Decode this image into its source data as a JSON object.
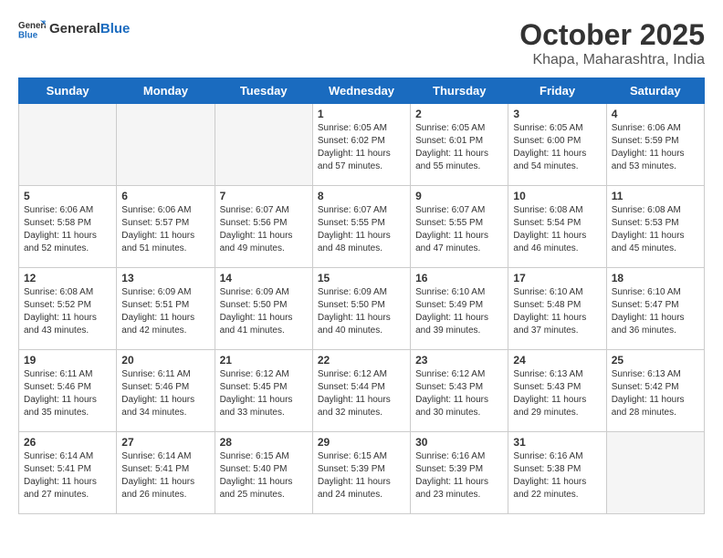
{
  "header": {
    "logo_general": "General",
    "logo_blue": "Blue",
    "title": "October 2025",
    "subtitle": "Khapa, Maharashtra, India"
  },
  "weekdays": [
    "Sunday",
    "Monday",
    "Tuesday",
    "Wednesday",
    "Thursday",
    "Friday",
    "Saturday"
  ],
  "weeks": [
    [
      {
        "day": "",
        "empty": true
      },
      {
        "day": "",
        "empty": true
      },
      {
        "day": "",
        "empty": true
      },
      {
        "day": "1",
        "sunrise": "6:05 AM",
        "sunset": "6:02 PM",
        "daylight": "11 hours and 57 minutes."
      },
      {
        "day": "2",
        "sunrise": "6:05 AM",
        "sunset": "6:01 PM",
        "daylight": "11 hours and 55 minutes."
      },
      {
        "day": "3",
        "sunrise": "6:05 AM",
        "sunset": "6:00 PM",
        "daylight": "11 hours and 54 minutes."
      },
      {
        "day": "4",
        "sunrise": "6:06 AM",
        "sunset": "5:59 PM",
        "daylight": "11 hours and 53 minutes."
      }
    ],
    [
      {
        "day": "5",
        "sunrise": "6:06 AM",
        "sunset": "5:58 PM",
        "daylight": "11 hours and 52 minutes."
      },
      {
        "day": "6",
        "sunrise": "6:06 AM",
        "sunset": "5:57 PM",
        "daylight": "11 hours and 51 minutes."
      },
      {
        "day": "7",
        "sunrise": "6:07 AM",
        "sunset": "5:56 PM",
        "daylight": "11 hours and 49 minutes."
      },
      {
        "day": "8",
        "sunrise": "6:07 AM",
        "sunset": "5:55 PM",
        "daylight": "11 hours and 48 minutes."
      },
      {
        "day": "9",
        "sunrise": "6:07 AM",
        "sunset": "5:55 PM",
        "daylight": "11 hours and 47 minutes."
      },
      {
        "day": "10",
        "sunrise": "6:08 AM",
        "sunset": "5:54 PM",
        "daylight": "11 hours and 46 minutes."
      },
      {
        "day": "11",
        "sunrise": "6:08 AM",
        "sunset": "5:53 PM",
        "daylight": "11 hours and 45 minutes."
      }
    ],
    [
      {
        "day": "12",
        "sunrise": "6:08 AM",
        "sunset": "5:52 PM",
        "daylight": "11 hours and 43 minutes."
      },
      {
        "day": "13",
        "sunrise": "6:09 AM",
        "sunset": "5:51 PM",
        "daylight": "11 hours and 42 minutes."
      },
      {
        "day": "14",
        "sunrise": "6:09 AM",
        "sunset": "5:50 PM",
        "daylight": "11 hours and 41 minutes."
      },
      {
        "day": "15",
        "sunrise": "6:09 AM",
        "sunset": "5:50 PM",
        "daylight": "11 hours and 40 minutes."
      },
      {
        "day": "16",
        "sunrise": "6:10 AM",
        "sunset": "5:49 PM",
        "daylight": "11 hours and 39 minutes."
      },
      {
        "day": "17",
        "sunrise": "6:10 AM",
        "sunset": "5:48 PM",
        "daylight": "11 hours and 37 minutes."
      },
      {
        "day": "18",
        "sunrise": "6:10 AM",
        "sunset": "5:47 PM",
        "daylight": "11 hours and 36 minutes."
      }
    ],
    [
      {
        "day": "19",
        "sunrise": "6:11 AM",
        "sunset": "5:46 PM",
        "daylight": "11 hours and 35 minutes."
      },
      {
        "day": "20",
        "sunrise": "6:11 AM",
        "sunset": "5:46 PM",
        "daylight": "11 hours and 34 minutes."
      },
      {
        "day": "21",
        "sunrise": "6:12 AM",
        "sunset": "5:45 PM",
        "daylight": "11 hours and 33 minutes."
      },
      {
        "day": "22",
        "sunrise": "6:12 AM",
        "sunset": "5:44 PM",
        "daylight": "11 hours and 32 minutes."
      },
      {
        "day": "23",
        "sunrise": "6:12 AM",
        "sunset": "5:43 PM",
        "daylight": "11 hours and 30 minutes."
      },
      {
        "day": "24",
        "sunrise": "6:13 AM",
        "sunset": "5:43 PM",
        "daylight": "11 hours and 29 minutes."
      },
      {
        "day": "25",
        "sunrise": "6:13 AM",
        "sunset": "5:42 PM",
        "daylight": "11 hours and 28 minutes."
      }
    ],
    [
      {
        "day": "26",
        "sunrise": "6:14 AM",
        "sunset": "5:41 PM",
        "daylight": "11 hours and 27 minutes."
      },
      {
        "day": "27",
        "sunrise": "6:14 AM",
        "sunset": "5:41 PM",
        "daylight": "11 hours and 26 minutes."
      },
      {
        "day": "28",
        "sunrise": "6:15 AM",
        "sunset": "5:40 PM",
        "daylight": "11 hours and 25 minutes."
      },
      {
        "day": "29",
        "sunrise": "6:15 AM",
        "sunset": "5:39 PM",
        "daylight": "11 hours and 24 minutes."
      },
      {
        "day": "30",
        "sunrise": "6:16 AM",
        "sunset": "5:39 PM",
        "daylight": "11 hours and 23 minutes."
      },
      {
        "day": "31",
        "sunrise": "6:16 AM",
        "sunset": "5:38 PM",
        "daylight": "11 hours and 22 minutes."
      },
      {
        "day": "",
        "empty": true
      }
    ]
  ]
}
